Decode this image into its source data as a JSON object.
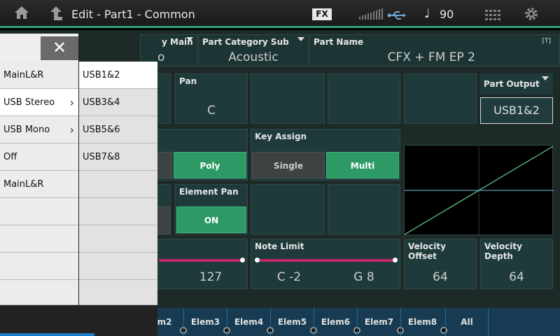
{
  "topbar": {
    "title": "Edit - Part1 - Common",
    "fx_label": "FX",
    "tempo_note": "♩",
    "tempo": "90",
    "icons": [
      "home-icon",
      "up-arrow-icon",
      "meter-icon",
      "usb-icon",
      "grid-icon",
      "gear-icon"
    ]
  },
  "params": {
    "category_main_label": "y Main",
    "category_main_value": "o",
    "category_sub_label": "Part Category Sub",
    "category_sub_value": "Acoustic",
    "part_name_label": "Part Name",
    "part_name_value": "CFX + FM EP 2",
    "part_name_badge": "[T]",
    "pan_label": "Pan",
    "pan_value": "C",
    "part_output_label": "Part Output",
    "part_output_value": "USB1&2",
    "poly_label": "Poly",
    "key_assign_label": "Key Assign",
    "single_label": "Single",
    "multi_label": "Multi",
    "element_pan_label": "Element Pan",
    "element_pan_value": "ON",
    "velocity_limit_high": "127",
    "note_limit_label": "Note Limit",
    "note_limit_low": "C -2",
    "note_limit_high": "G 8",
    "velocity_offset_label": "Velocity Offset",
    "velocity_offset_value": "64",
    "velocity_depth_label": "Velocity Depth",
    "velocity_depth_value": "64"
  },
  "tabs": [
    "em2",
    "Elem3",
    "Elem4",
    "Elem5",
    "Elem6",
    "Elem7",
    "Elem8",
    "All"
  ],
  "popup": {
    "close_symbol": "✕",
    "options": [
      "MainL&R",
      "USB Stereo",
      "USB Mono",
      "Off",
      "MainL&R"
    ],
    "selected_option": "USB Stereo",
    "sub_options": [
      "USB1&2",
      "USB3&4",
      "USB5&6",
      "USB7&8"
    ],
    "selected_sub_option": "USB1&2"
  },
  "colors": {
    "accent_green": "#2d9a66",
    "slider_magenta": "#c0276c",
    "tab_blue": "#173b52"
  }
}
